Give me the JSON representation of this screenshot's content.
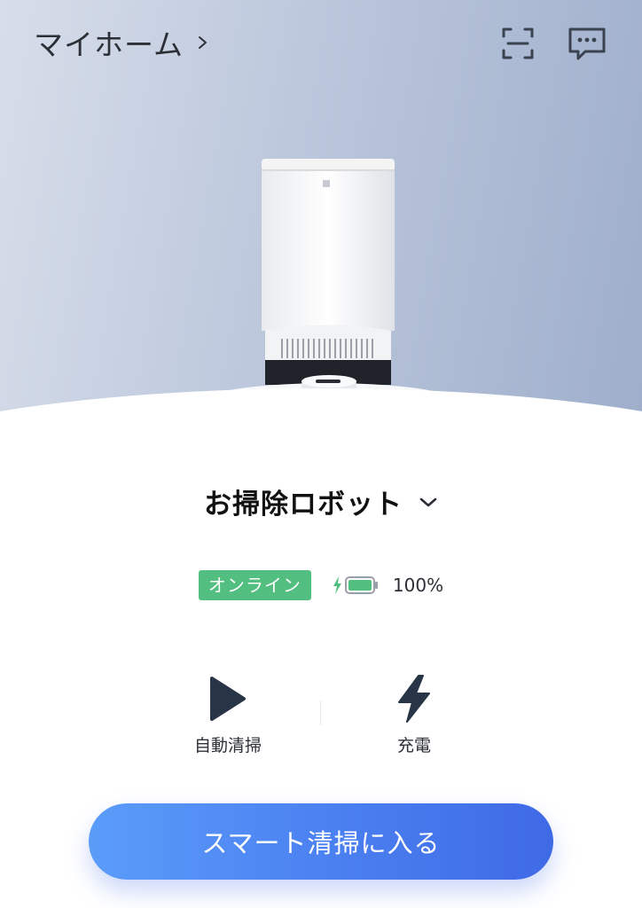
{
  "header": {
    "home_title": "マイホーム",
    "home_chevron_icon": "chevron-right-icon",
    "scan_icon": "scan-icon",
    "message_icon": "message-icon"
  },
  "hero": {
    "illustration": "robot-vacuum-with-auto-empty-station"
  },
  "device": {
    "name": "お掃除ロボット",
    "dropdown_icon": "chevron-down-icon"
  },
  "status": {
    "connection": "オンライン",
    "battery_percent": "100%",
    "battery_level": 1.0,
    "charging": true
  },
  "actions": [
    {
      "label": "自動清掃",
      "icon": "play-icon"
    },
    {
      "label": "充電",
      "icon": "lightning-icon"
    }
  ],
  "cta": {
    "label": "スマート清掃に入る"
  },
  "colors": {
    "accent": "#4a7ff0",
    "online": "#52be80",
    "icon_dark": "#283546",
    "text": "#2c3036"
  }
}
